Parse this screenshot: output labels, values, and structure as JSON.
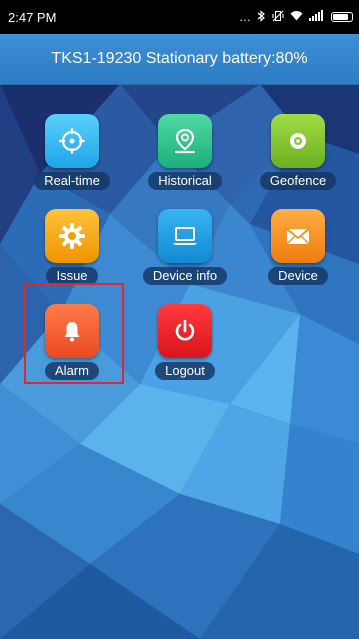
{
  "status_bar": {
    "time": "2:47 PM",
    "icons": [
      "more-dots-icon",
      "bluetooth-icon",
      "vibrate-off-icon",
      "wifi-icon",
      "signal-icon",
      "battery-icon"
    ]
  },
  "header": {
    "title": "TKS1-19230 Stationary battery:80%"
  },
  "menu": {
    "items": [
      {
        "label": "Real-time",
        "icon": "crosshair-icon",
        "color": "#2fb8f2"
      },
      {
        "label": "Historical",
        "icon": "map-pin-icon",
        "color": "#2cc48b"
      },
      {
        "label": "Geofence",
        "icon": "target-icon",
        "color": "#86c630"
      },
      {
        "label": "Issue",
        "icon": "gear-icon",
        "color": "#f5a20a"
      },
      {
        "label": "Device info",
        "icon": "laptop-icon",
        "color": "#1a9ee2"
      },
      {
        "label": "Device",
        "icon": "envelope-icon",
        "color": "#f4921e"
      },
      {
        "label": "Alarm",
        "icon": "bell-icon",
        "color": "#f05a30"
      },
      {
        "label": "Logout",
        "icon": "power-icon",
        "color": "#e8232b"
      }
    ]
  }
}
